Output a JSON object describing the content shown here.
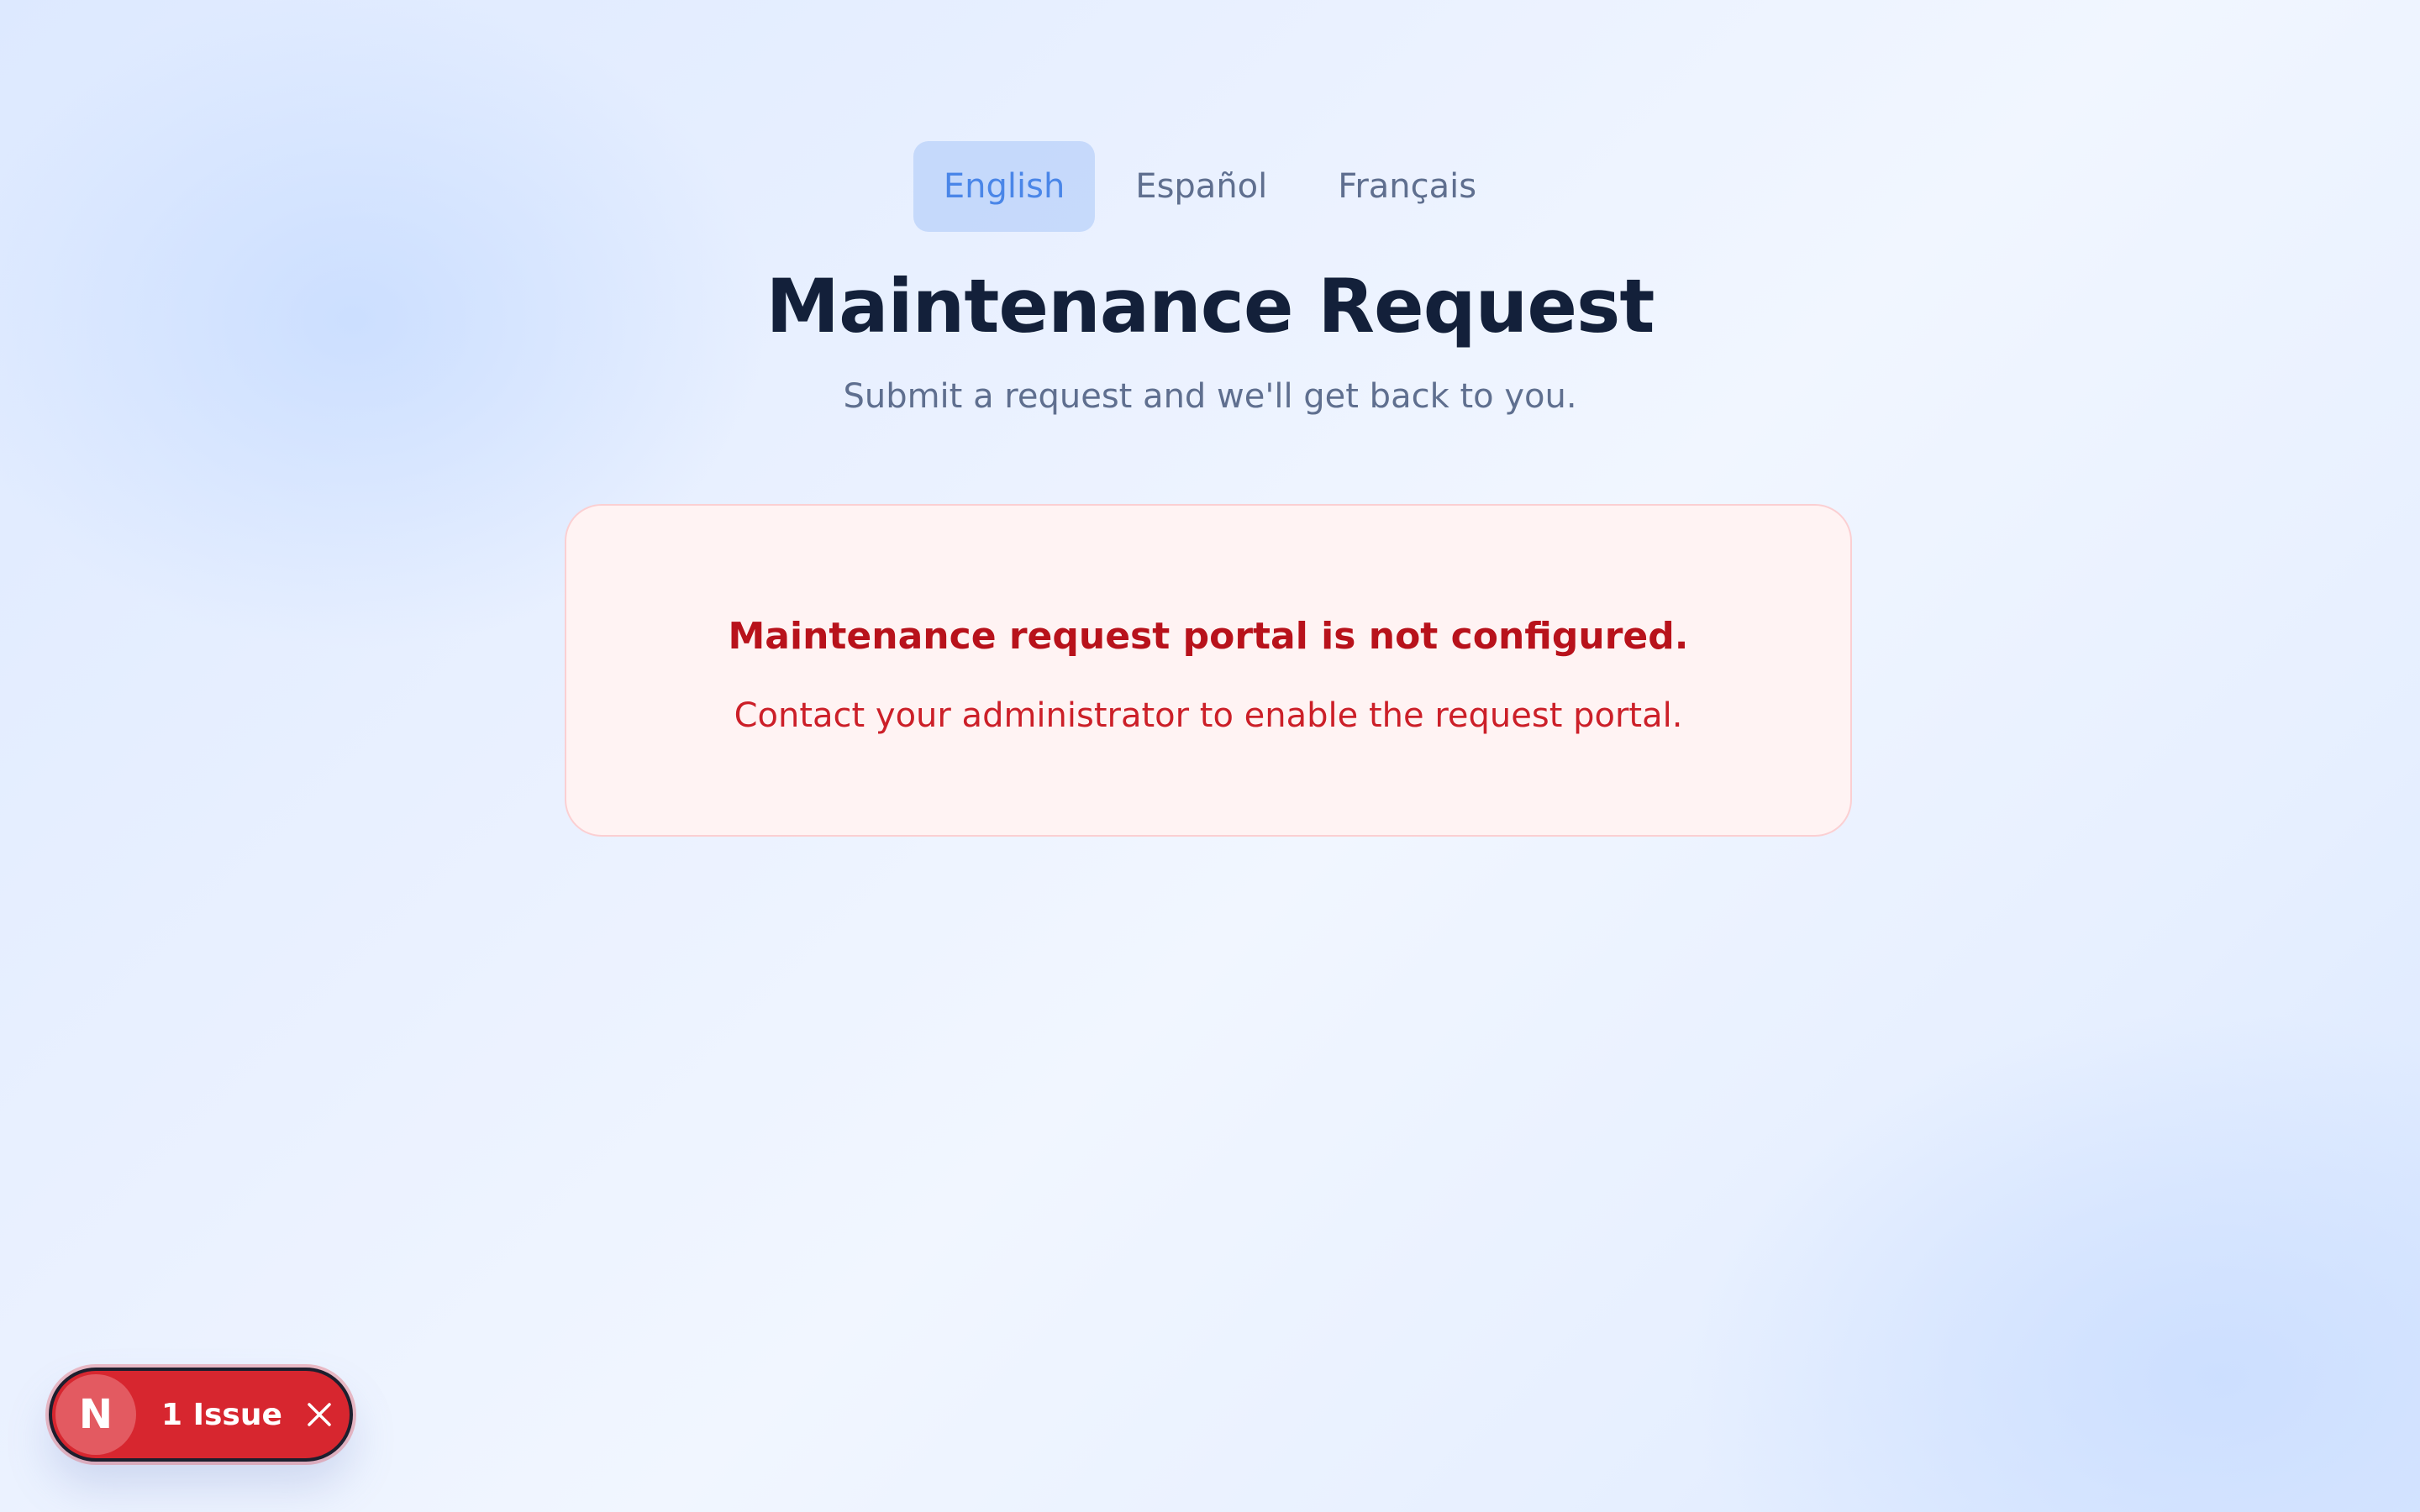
{
  "language_tabs": [
    {
      "label": "English",
      "active": true
    },
    {
      "label": "Español",
      "active": false
    },
    {
      "label": "Français",
      "active": false
    }
  ],
  "header": {
    "title": "Maintenance Request",
    "subtitle": "Submit a request and we'll get back to you."
  },
  "error": {
    "title": "Maintenance request portal is not configured.",
    "message": "Contact your administrator to enable the request portal."
  },
  "dev_overlay": {
    "logo_letter": "N",
    "issue_label": "1 Issue",
    "close_icon": "close-icon"
  },
  "colors": {
    "accent": "#4a86e8",
    "title": "#13203a",
    "error_text": "#b8121b",
    "error_bg": "#fff3f3",
    "issue_bg": "#d7262f"
  }
}
